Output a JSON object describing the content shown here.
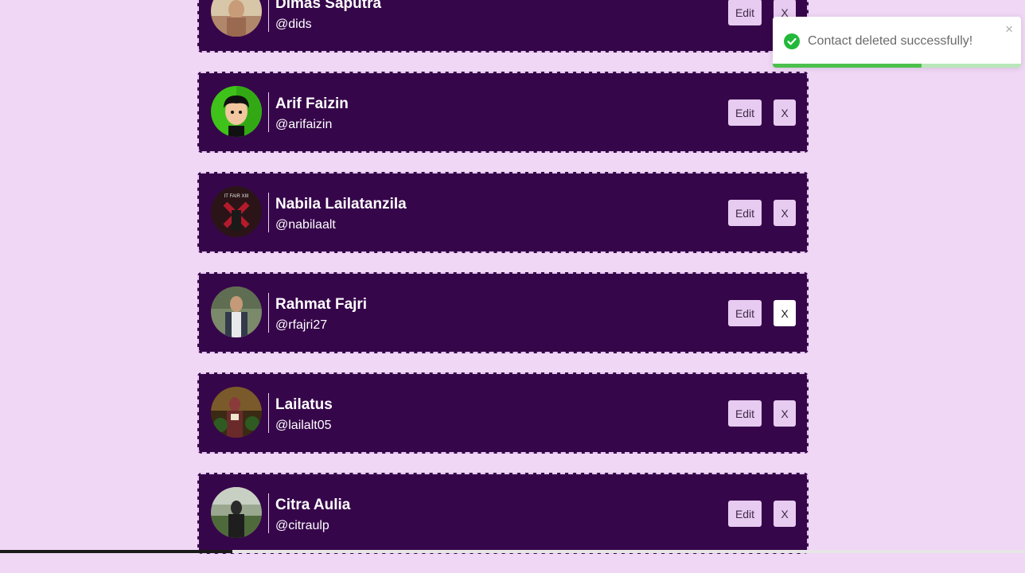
{
  "contacts": [
    {
      "name": "Dimas Saputra",
      "handle": "@dids",
      "edit_label": "Edit",
      "delete_label": "X",
      "avatar": "photo-person-praying"
    },
    {
      "name": "Arif Faizin",
      "handle": "@arifaizin",
      "edit_label": "Edit",
      "delete_label": "X",
      "avatar": "cartoon-avatar-green"
    },
    {
      "name": "Nabila Lailatanzila",
      "handle": "@nabilaalt",
      "edit_label": "Edit",
      "delete_label": "X",
      "avatar": "photo-it-fair-stage"
    },
    {
      "name": "Rahmat Fajri",
      "handle": "@rfajri27",
      "edit_label": "Edit",
      "delete_label": "X",
      "avatar": "photo-person-plaid-shirt"
    },
    {
      "name": "Lailatus",
      "handle": "@lailalt05",
      "edit_label": "Edit",
      "delete_label": "X",
      "avatar": "photo-person-with-certificate"
    },
    {
      "name": "Citra Aulia",
      "handle": "@citraulp",
      "edit_label": "Edit",
      "delete_label": "X",
      "avatar": "photo-person-outdoors"
    }
  ],
  "avatar_texts": {
    "it_fair": "IT FAIR XIII"
  },
  "toast": {
    "message": "Contact deleted successfully!",
    "close_label": "×",
    "icon": "check-circle-icon",
    "progress": 0.6
  },
  "colors": {
    "background": "#f0d7f6",
    "card": "#36064a",
    "button": "#e7cbf0",
    "success": "#22b83a"
  }
}
